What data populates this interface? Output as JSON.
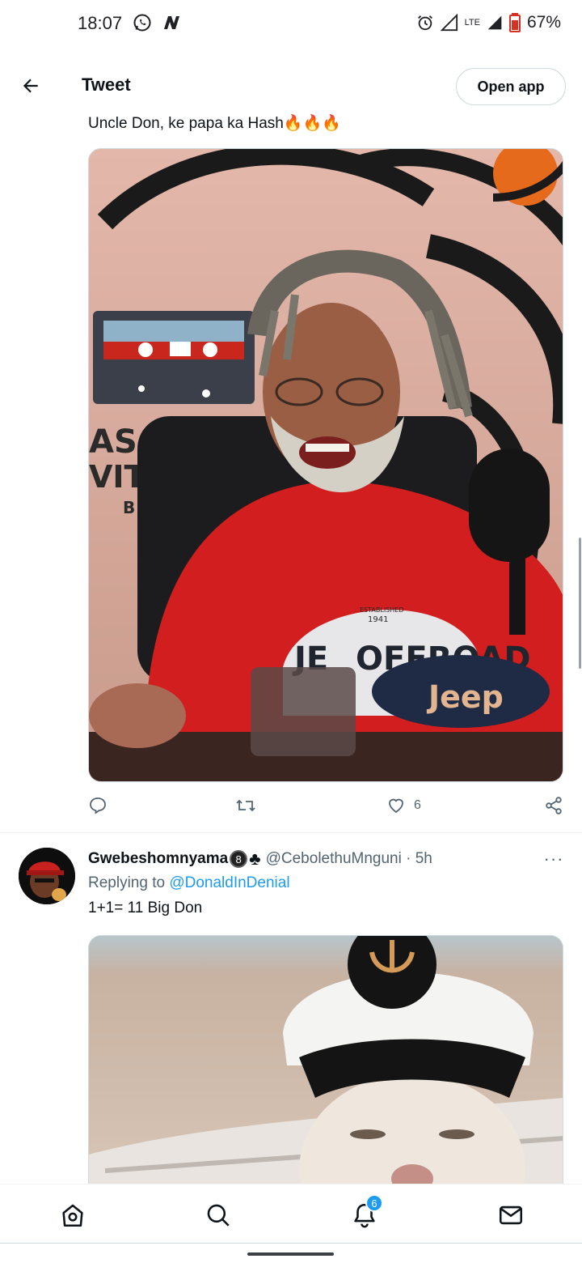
{
  "status_bar": {
    "time": "18:07",
    "lte_label": "LTE",
    "battery": "67%",
    "icons": [
      "whatsapp-icon",
      "n-app-icon",
      "alarm-icon",
      "signal-icon",
      "battery-icon"
    ]
  },
  "header": {
    "title": "Tweet",
    "open_app_label": "Open app",
    "back_icon": "arrow-left-icon"
  },
  "tweet1": {
    "text": "Uncle Don, ke papa ka Hash🔥🔥🔥",
    "photo_text": {
      "offroad": "OFFROAD",
      "jeep": "Jeep",
      "logo_ref": "JE",
      "side_letters_1": "AS",
      "side_letters_2": "VIT",
      "side_letters_3": "B",
      "established": "ESTABLISHED",
      "year": "1941"
    },
    "actions": {
      "reply_count": "",
      "retweet_count": "",
      "like_count": "6"
    }
  },
  "tweet2": {
    "name": "Gwebeshomnyama",
    "badge": "8",
    "club": "♣",
    "handle": "@CebolethuMnguni · 5h",
    "replying_prefix": "Replying to ",
    "replying_to": "@DonaldInDenial",
    "text": "1+1= 11 Big Don",
    "more": "···"
  },
  "bottom_nav": {
    "notifications_count": "6",
    "items": [
      "home-icon",
      "search-icon",
      "notifications-icon",
      "messages-icon"
    ]
  },
  "colors": {
    "accent": "#1d9bf0",
    "text_primary": "#0f1419",
    "text_secondary": "#536471",
    "border": "#cfd9de"
  }
}
